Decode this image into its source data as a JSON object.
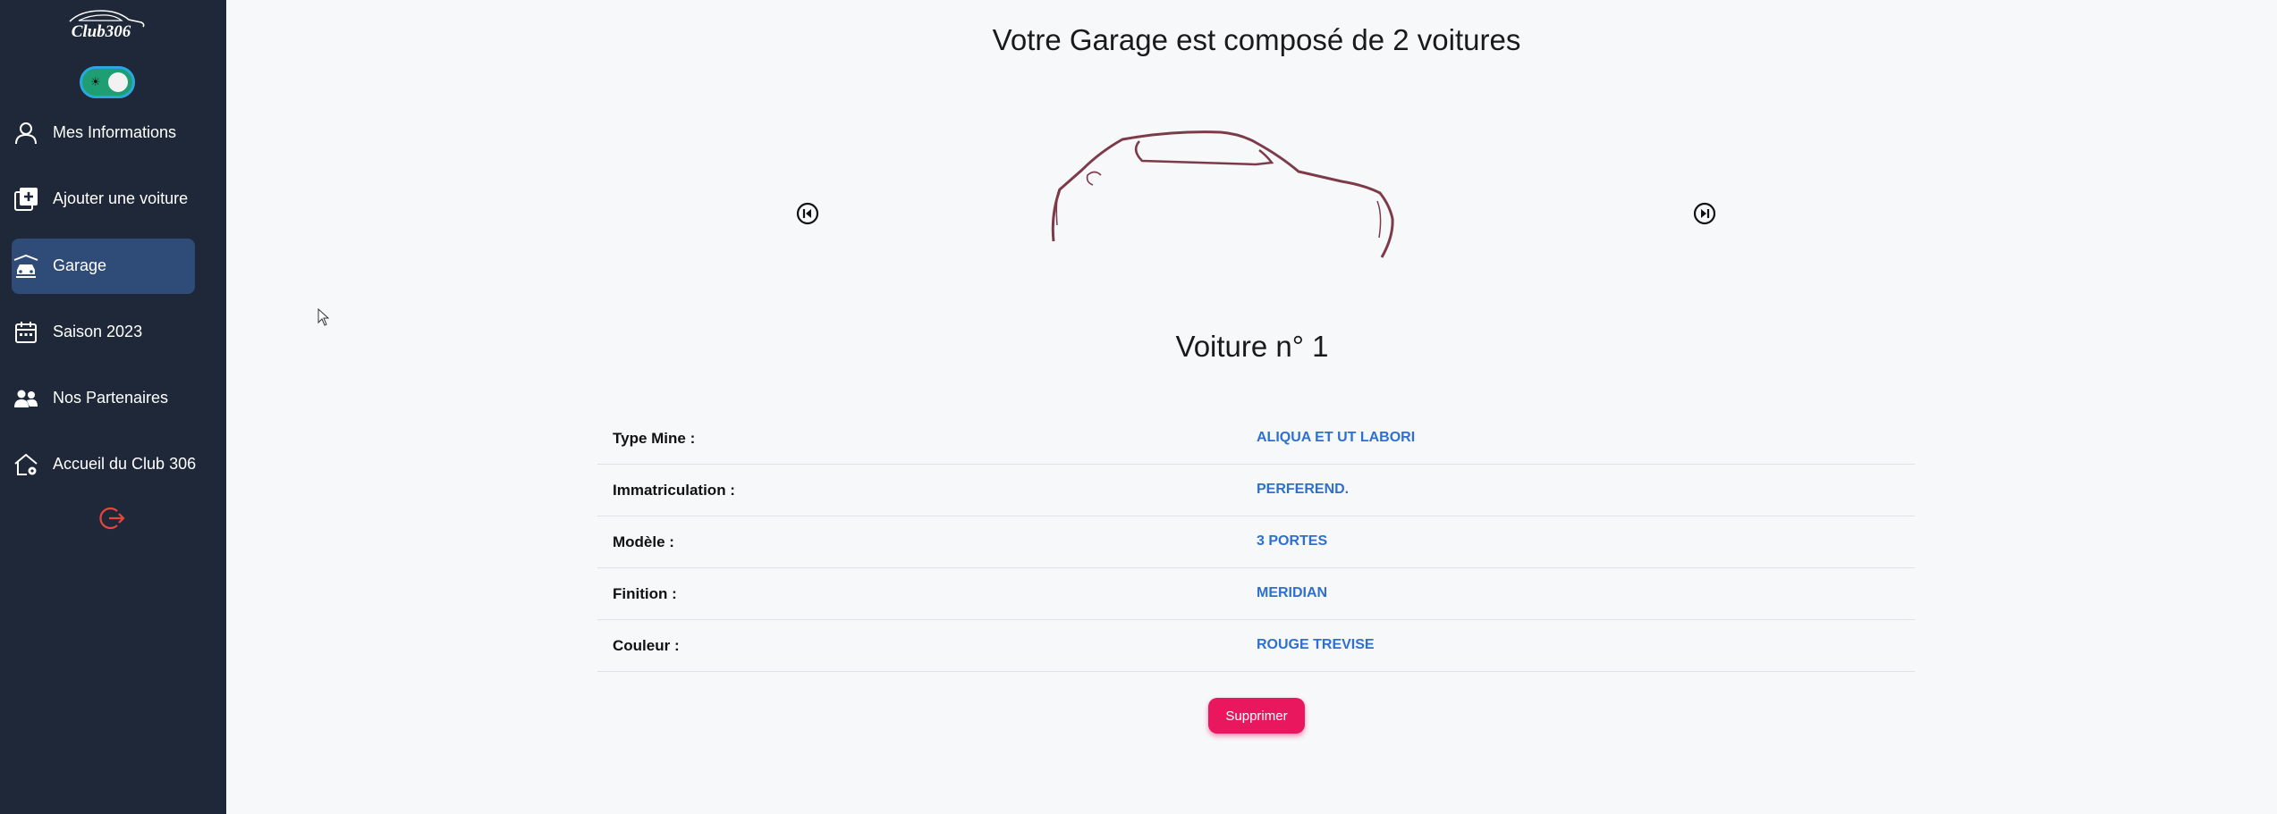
{
  "app": {
    "logo_text": "Club306"
  },
  "sidebar": {
    "theme_toggle": {
      "state": "on",
      "icon": "sun-icon"
    },
    "items": [
      {
        "label": "Mes Informations",
        "icon": "user-icon",
        "active": false
      },
      {
        "label": "Ajouter une voiture",
        "icon": "add-box-icon",
        "active": false
      },
      {
        "label": "Garage",
        "icon": "garage-car-icon",
        "active": true
      },
      {
        "label": "Saison 2023",
        "icon": "calendar-icon",
        "active": false
      },
      {
        "label": "Nos Partenaires",
        "icon": "people-icon",
        "active": false
      },
      {
        "label": "Accueil du Club 306",
        "icon": "home-icon",
        "active": false
      }
    ],
    "logout_icon": "logout-icon"
  },
  "main": {
    "title": "Votre Garage est composé de 2 voitures",
    "car_title": "Voiture n° 1",
    "specs": [
      {
        "label": "Type Mine :",
        "value": "ALIQUA ET UT LABORI"
      },
      {
        "label": "Immatriculation :",
        "value": "PERFEREND."
      },
      {
        "label": "Modèle :",
        "value": "3 PORTES"
      },
      {
        "label": "Finition :",
        "value": "MERIDIAN"
      },
      {
        "label": "Couleur :",
        "value": "ROUGE TREVISE"
      }
    ],
    "delete_label": "Supprimer"
  },
  "colors": {
    "sidebar_bg": "#1e2838",
    "active_item_bg": "#2f4b78",
    "value_text": "#2f6fd0",
    "delete_button": "#e9175e",
    "car_outline": "#7d3b4a",
    "logout_icon": "#e8453c"
  }
}
